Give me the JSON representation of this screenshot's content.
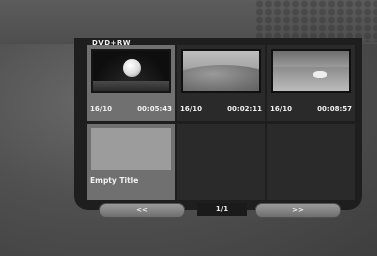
{
  "menu": {
    "disc_type": "DVD+RW"
  },
  "titles": [
    {
      "date": "16/10",
      "duration": "00:05:43",
      "thumbnail": "ball-on-dark-ground",
      "selected": true
    },
    {
      "date": "16/10",
      "duration": "00:02:11",
      "thumbnail": "grassy-hill-landscape",
      "selected": false
    },
    {
      "date": "16/10",
      "duration": "00:08:57",
      "thumbnail": "animal-in-field",
      "selected": false
    }
  ],
  "empty_slot": {
    "label": "Empty Title",
    "selected": true
  },
  "navigation": {
    "prev_label": "<<",
    "page_indicator": "1/1",
    "next_label": ">>"
  },
  "colors": {
    "background": "#4a4a4a",
    "panel": "#1e1e1e",
    "selected_cell": "#707070",
    "text": "#f0f0f0"
  }
}
